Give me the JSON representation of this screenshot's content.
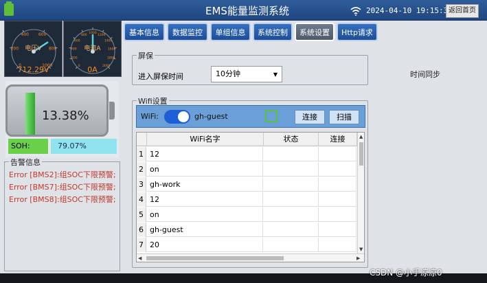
{
  "titlebar": {
    "title": "EMS能量监测系统",
    "datetime": "2024-04-10 19:15:36",
    "back_label": "返回首页"
  },
  "gauges": [
    {
      "unit": "电压V",
      "value": "712.29V",
      "ticks": [
        "0",
        "200",
        "400",
        "600",
        "800",
        "1000"
      ],
      "level": 0.71
    },
    {
      "unit": "电流A",
      "value": "0A",
      "ticks": [
        "0",
        "200",
        "400",
        "600",
        "800",
        "1000",
        "1200",
        "1400",
        "1600",
        "1800",
        "2000"
      ],
      "level": 0.5
    }
  ],
  "tabs": [
    {
      "label": "基本信息",
      "active": false
    },
    {
      "label": "数据监控",
      "active": false
    },
    {
      "label": "单组信息",
      "active": false
    },
    {
      "label": "系统控制",
      "active": false
    },
    {
      "label": "系统设置",
      "active": true
    },
    {
      "label": "Http请求",
      "active": false
    }
  ],
  "battery": {
    "percent_label": "13.38%",
    "level": 0.1338,
    "soh_label": "SOH:",
    "soh_value": "79.07%"
  },
  "alarm": {
    "title": "告警信息",
    "items": [
      "Error [BMS2]:组SOC下限预警;",
      "Error [BMS7]:组SOC下限预警;",
      "Error [BMS8]:组SOC下限预警;"
    ]
  },
  "screensaver": {
    "title": "屏保",
    "label": "进入屏保时间",
    "selected": "10分钟"
  },
  "time_sync": {
    "label": "时间同步"
  },
  "wifi": {
    "title": "Wifi设置",
    "label": "WiFi:",
    "enabled": true,
    "ssid": "gh-guest",
    "connect_label": "连接",
    "scan_label": "扫描",
    "columns": [
      "WiFi名字",
      "状态",
      "连接"
    ],
    "rows": [
      {
        "idx": "1",
        "name": "12"
      },
      {
        "idx": "2",
        "name": "on"
      },
      {
        "idx": "3",
        "name": "gh-work"
      },
      {
        "idx": "4",
        "name": "12"
      },
      {
        "idx": "5",
        "name": "on"
      },
      {
        "idx": "6",
        "name": "gh-guest"
      },
      {
        "idx": "7",
        "name": "20"
      }
    ]
  },
  "watermark": "CSDN @小手凉凉0"
}
